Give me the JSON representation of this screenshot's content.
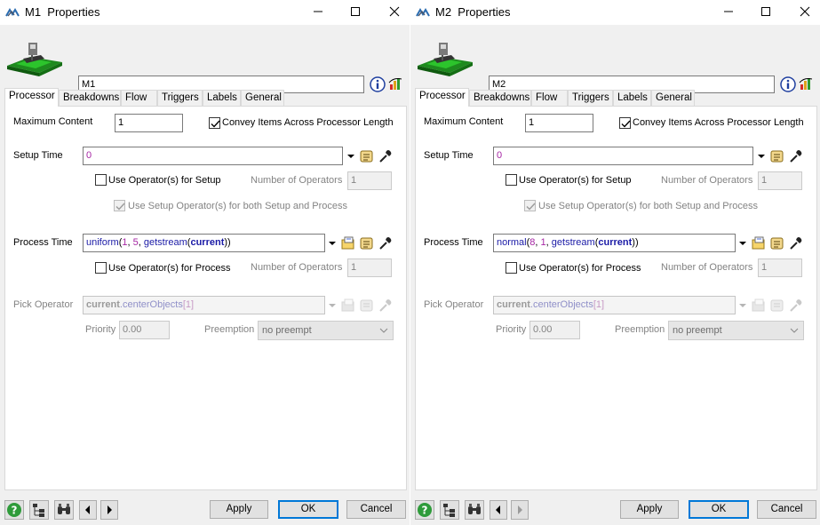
{
  "windows": [
    {
      "title": "M1  Properties",
      "name": "M1",
      "tabs": [
        "Processor",
        "Breakdowns",
        "Flow",
        "Triggers",
        "Labels",
        "General"
      ],
      "max_content_label": "Maximum Content",
      "max_content_value": "1",
      "convey_label": "Convey Items Across Processor Length",
      "convey_checked": true,
      "setup_time_label": "Setup Time",
      "setup_time_value": "0",
      "use_op_setup_label": "Use Operator(s) for Setup",
      "num_operators_label": "Number of Operators",
      "num_operators_setup": "1",
      "use_setup_both_label": "Use Setup Operator(s) for both Setup and Process",
      "process_time_label": "Process Time",
      "process_time_expr": {
        "fn": "uniform",
        "open": "(",
        "a": "1",
        "sep1": ", ",
        "b": "5",
        "sep2": ", ",
        "stream_fn": "getstream",
        "stream_open": "(",
        "stream_arg": "current",
        "close": "))"
      },
      "use_op_process_label": "Use Operator(s) for Process",
      "num_operators_process": "1",
      "pick_operator_label": "Pick Operator",
      "pick_operator_expr": {
        "obj": "current",
        "prop": ".centerObjects",
        "idx": "[1]"
      },
      "priority_label": "Priority",
      "priority_value": "0.00",
      "preemption_label": "Preemption",
      "preemption_value": "no preempt"
    },
    {
      "title": "M2  Properties",
      "name": "M2",
      "tabs": [
        "Processor",
        "Breakdowns",
        "Flow",
        "Triggers",
        "Labels",
        "General"
      ],
      "max_content_label": "Maximum Content",
      "max_content_value": "1",
      "convey_label": "Convey Items Across Processor Length",
      "convey_checked": true,
      "setup_time_label": "Setup Time",
      "setup_time_value": "0",
      "use_op_setup_label": "Use Operator(s) for Setup",
      "num_operators_label": "Number of Operators",
      "num_operators_setup": "1",
      "use_setup_both_label": "Use Setup Operator(s) for both Setup and Process",
      "process_time_label": "Process Time",
      "process_time_expr": {
        "fn": "normal",
        "open": "(",
        "a": "8",
        "sep1": ", ",
        "b": "1",
        "sep2": ", ",
        "stream_fn": "getstream",
        "stream_open": "(",
        "stream_arg": "current",
        "close": "))"
      },
      "use_op_process_label": "Use Operator(s) for Process",
      "num_operators_process": "1",
      "pick_operator_label": "Pick Operator",
      "pick_operator_expr": {
        "obj": "current",
        "prop": ".centerObjects",
        "idx": "[1]"
      },
      "priority_label": "Priority",
      "priority_value": "0.00",
      "preemption_label": "Preemption",
      "preemption_value": "no preempt"
    }
  ],
  "footer": {
    "apply": "Apply",
    "ok": "OK",
    "cancel": "Cancel"
  },
  "icons": {
    "title": "flexsim-logo-icon",
    "minimize": "minimize-icon",
    "maximize": "maximize-icon",
    "close": "close-icon",
    "info": "info-icon",
    "stats": "statistics-icon",
    "dropdown": "dropdown-arrow-icon",
    "template": "code-template-icon",
    "script": "script-edit-icon",
    "picker": "eyedropper-icon",
    "help": "help-icon",
    "tree": "tree-view-icon",
    "find": "binoculars-icon",
    "prev": "previous-arrow-icon",
    "next": "next-arrow-icon"
  },
  "colors": {
    "expr_value": "#a626a4",
    "expr_keyword": "#1a1aa6",
    "ok_border": "#0078d7"
  }
}
